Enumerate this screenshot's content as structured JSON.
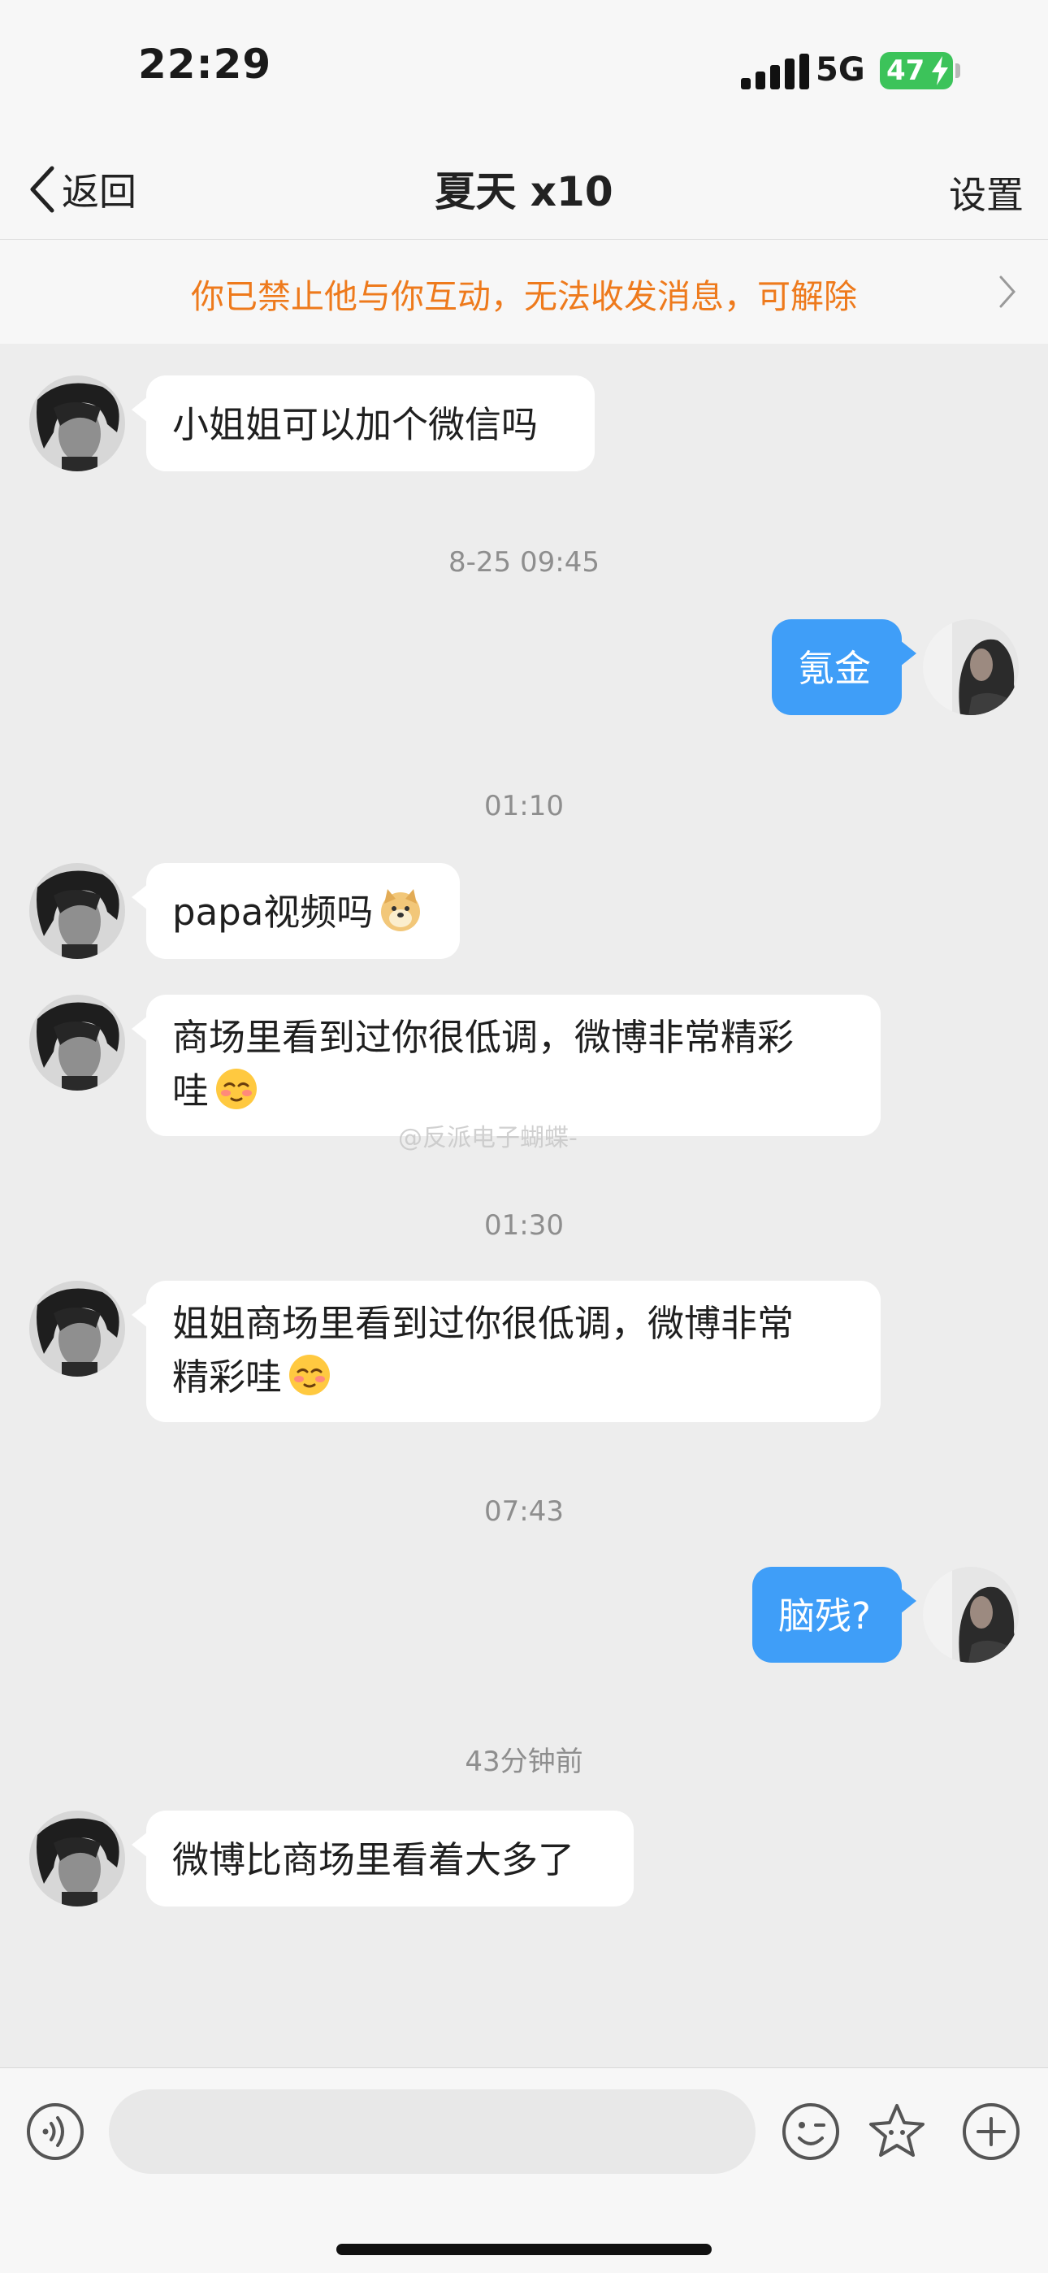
{
  "status_bar": {
    "time": "22:29",
    "network": "5G",
    "battery": "47"
  },
  "nav": {
    "back_label": "返回",
    "title": "夏天 x10",
    "settings_label": "设置"
  },
  "banner": {
    "text": "你已禁止他与你互动，无法收发消息，可解除"
  },
  "messages": [
    {
      "type": "incoming",
      "text": "小姐姐可以加个微信吗"
    },
    {
      "type": "timestamp",
      "text": "8-25 09:45"
    },
    {
      "type": "outgoing",
      "text": "氪金"
    },
    {
      "type": "timestamp",
      "text": "01:10"
    },
    {
      "type": "incoming",
      "text": "papa视频吗",
      "emoji": "doge-emoji"
    },
    {
      "type": "incoming",
      "lines": [
        "商场里看到过你很低调，微博非常精彩",
        "哇"
      ],
      "emoji": "blush-emoji"
    },
    {
      "type": "timestamp",
      "text": "01:30"
    },
    {
      "type": "incoming",
      "lines": [
        "姐姐商场里看到过你很低调，微博非常",
        "精彩哇"
      ],
      "emoji": "blush-emoji"
    },
    {
      "type": "timestamp",
      "text": "07:43"
    },
    {
      "type": "outgoing",
      "text": "脑残?"
    },
    {
      "type": "timestamp",
      "text": "43分钟前"
    },
    {
      "type": "incoming",
      "text": "微博比商场里看着大多了"
    }
  ],
  "watermark": "@反派电子蝴蝶-",
  "composer": {
    "placeholder": ""
  },
  "icons": [
    "back-chevron-icon",
    "voice-icon",
    "smile-icon",
    "star-icon",
    "plus-icon",
    "chevron-right-icon"
  ],
  "colors": {
    "outgoing_bubble": "#3f9ef8",
    "banner_text": "#ee7a1c",
    "battery": "#3cc35a"
  }
}
